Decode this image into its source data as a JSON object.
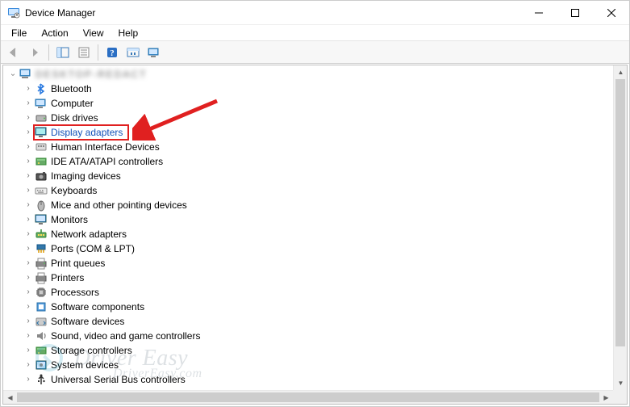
{
  "window": {
    "title": "Device Manager"
  },
  "menu": {
    "items": [
      "File",
      "Action",
      "View",
      "Help"
    ]
  },
  "toolbar": {
    "buttons": [
      {
        "name": "back-icon",
        "enabled": false
      },
      {
        "name": "forward-icon",
        "enabled": false
      },
      {
        "sep": true
      },
      {
        "name": "show-hide-tree-icon",
        "enabled": true
      },
      {
        "name": "properties-icon",
        "enabled": true
      },
      {
        "sep": true
      },
      {
        "name": "help-icon",
        "enabled": true
      },
      {
        "name": "action-icon",
        "enabled": true
      },
      {
        "name": "show-hidden-icon",
        "enabled": true
      }
    ]
  },
  "tree": {
    "root_label": "DESKTOP-REDACT",
    "items": [
      {
        "label": "Bluetooth",
        "icon": "bluetooth"
      },
      {
        "label": "Computer",
        "icon": "computer"
      },
      {
        "label": "Disk drives",
        "icon": "disk"
      },
      {
        "label": "Display adapters",
        "icon": "display",
        "highlighted": true
      },
      {
        "label": "Human Interface Devices",
        "icon": "hid"
      },
      {
        "label": "IDE ATA/ATAPI controllers",
        "icon": "ide"
      },
      {
        "label": "Imaging devices",
        "icon": "imaging"
      },
      {
        "label": "Keyboards",
        "icon": "keyboard"
      },
      {
        "label": "Mice and other pointing devices",
        "icon": "mouse"
      },
      {
        "label": "Monitors",
        "icon": "monitor"
      },
      {
        "label": "Network adapters",
        "icon": "network"
      },
      {
        "label": "Ports (COM & LPT)",
        "icon": "ports"
      },
      {
        "label": "Print queues",
        "icon": "printqueue"
      },
      {
        "label": "Printers",
        "icon": "printer"
      },
      {
        "label": "Processors",
        "icon": "cpu"
      },
      {
        "label": "Software components",
        "icon": "swcomp"
      },
      {
        "label": "Software devices",
        "icon": "swdev"
      },
      {
        "label": "Sound, video and game controllers",
        "icon": "sound"
      },
      {
        "label": "Storage controllers",
        "icon": "storage"
      },
      {
        "label": "System devices",
        "icon": "system"
      },
      {
        "label": "Universal Serial Bus controllers",
        "icon": "usb"
      }
    ]
  },
  "watermark": {
    "text": "Driver Easy",
    "sub": "DriverEasy.com"
  }
}
